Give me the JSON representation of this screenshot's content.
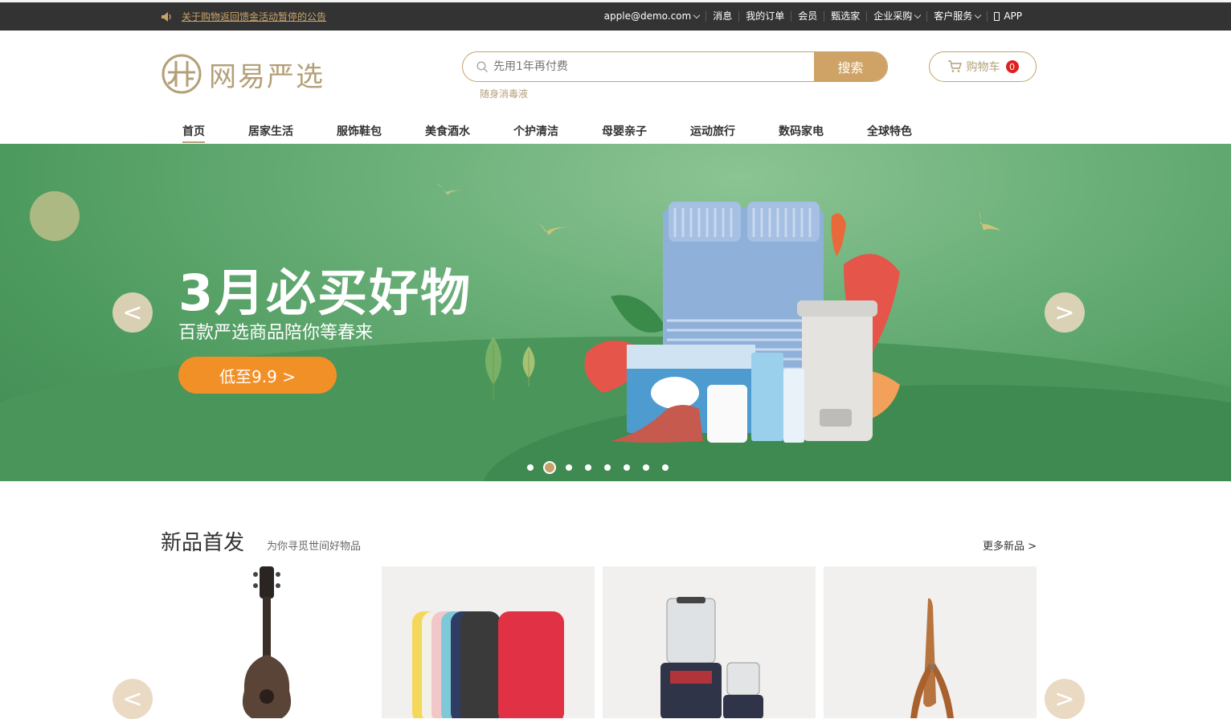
{
  "topbar": {
    "notice": "关于购物返回馈金活动暂停的公告",
    "links": [
      {
        "label": "apple@demo.com",
        "dropdown": true
      },
      {
        "label": "消息",
        "dropdown": false
      },
      {
        "label": "我的订单",
        "dropdown": false
      },
      {
        "label": "会员",
        "dropdown": false
      },
      {
        "label": "甄选家",
        "dropdown": false
      },
      {
        "label": "企业采购",
        "dropdown": true
      },
      {
        "label": "客户服务",
        "dropdown": true
      },
      {
        "label": "APP",
        "dropdown": false
      }
    ]
  },
  "header": {
    "logo_text": "网易严选",
    "search_placeholder": "先用1年再付费",
    "search_button": "搜索",
    "hot_keyword": "随身消毒液",
    "cart_label": "购物车",
    "cart_count": "0"
  },
  "nav": {
    "items": [
      "首页",
      "居家生活",
      "服饰鞋包",
      "美食酒水",
      "个护清洁",
      "母婴亲子",
      "运动旅行",
      "数码家电",
      "全球特色"
    ],
    "active_index": 0
  },
  "banner": {
    "title": "3月必买好物",
    "subtitle": "百款严选商品陪你等春来",
    "cta": "低至9.9 >",
    "prev": "<",
    "next": ">",
    "slide_count": 8,
    "active_slide": 1
  },
  "new_products": {
    "title": "新品首发",
    "subtitle": "为你寻觅世间好物品",
    "more": "更多新品 >",
    "prev": "<",
    "next": ">"
  },
  "colors": {
    "brand_gold": "#b4a078",
    "search_btn": "#cfa265",
    "cta_orange": "#f29028",
    "topbar_bg": "#333333"
  }
}
